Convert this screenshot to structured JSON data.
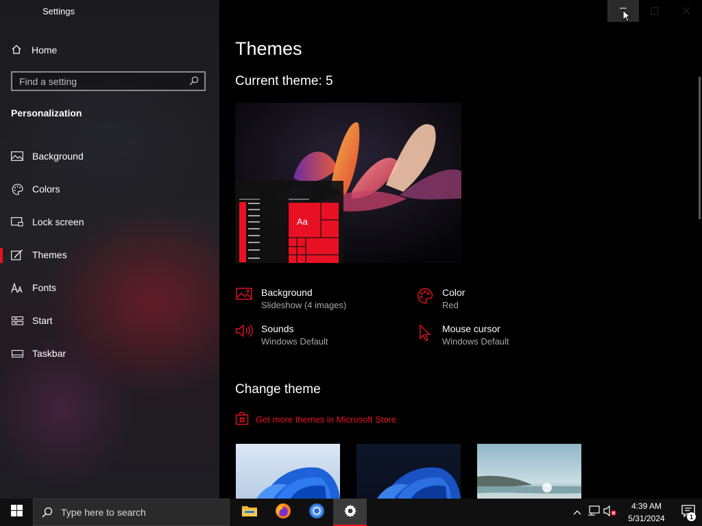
{
  "window": {
    "title": "Settings"
  },
  "sidebar": {
    "home_label": "Home",
    "search_placeholder": "Find a setting",
    "section_title": "Personalization",
    "items": [
      {
        "label": "Background",
        "icon": "image-icon"
      },
      {
        "label": "Colors",
        "icon": "palette-icon"
      },
      {
        "label": "Lock screen",
        "icon": "lock-screen-icon"
      },
      {
        "label": "Themes",
        "icon": "themes-brush-icon",
        "active": true
      },
      {
        "label": "Fonts",
        "icon": "fonts-icon"
      },
      {
        "label": "Start",
        "icon": "start-layout-icon"
      },
      {
        "label": "Taskbar",
        "icon": "taskbar-icon"
      }
    ]
  },
  "main": {
    "title": "Themes",
    "current_theme": "Current theme: 5",
    "preview_sample_text": "Aa",
    "properties": [
      {
        "name": "Background",
        "value": "Slideshow (4 images)",
        "icon": "image-icon"
      },
      {
        "name": "Color",
        "value": "Red",
        "icon": "palette-icon"
      },
      {
        "name": "Sounds",
        "value": "Windows Default",
        "icon": "speaker-icon"
      },
      {
        "name": "Mouse cursor",
        "value": "Windows Default",
        "icon": "cursor-icon"
      }
    ],
    "change_theme_title": "Change theme",
    "store_link": "Get more themes in Microsoft Store"
  },
  "taskbar": {
    "search_text": "Type here to search",
    "apps": [
      {
        "name": "File Explorer",
        "icon": "folder-icon"
      },
      {
        "name": "Firefox",
        "icon": "firefox-icon"
      },
      {
        "name": "Chrome",
        "icon": "chrome-icon"
      },
      {
        "name": "Settings",
        "icon": "gear-icon",
        "active": true
      }
    ],
    "time": "4:39 AM",
    "date": "5/31/2024",
    "notification_count": "1"
  },
  "colors": {
    "accent": "#e81123",
    "sidebar_bg": "#1f1f22",
    "main_bg": "#000000",
    "taskbar_bg": "#101010"
  }
}
